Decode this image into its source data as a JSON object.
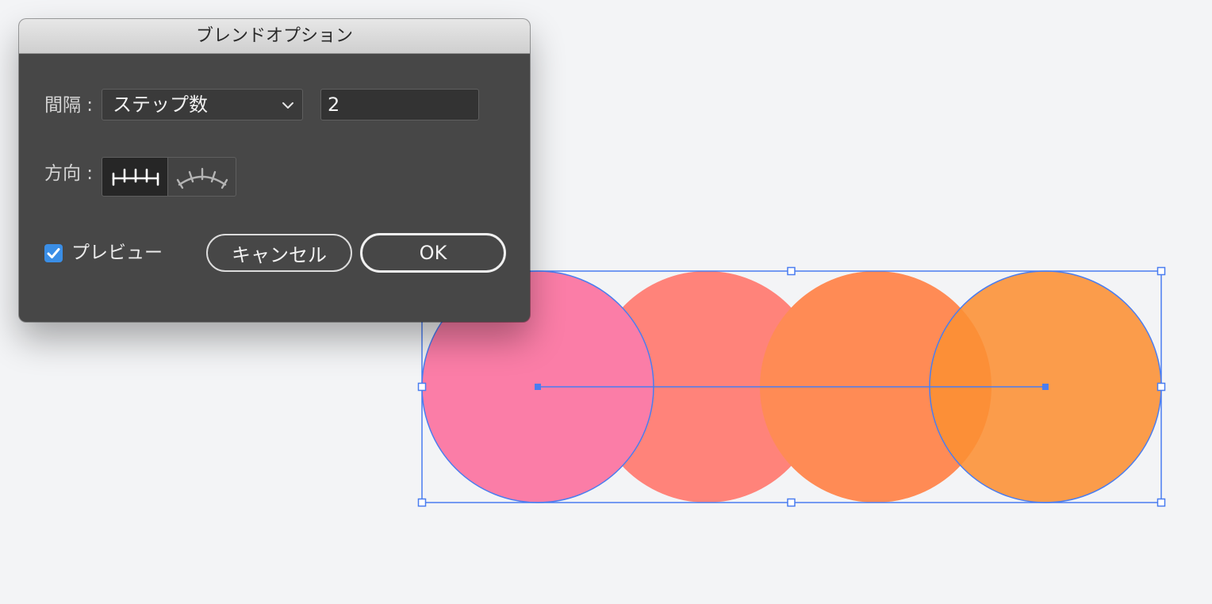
{
  "dialog": {
    "title": "ブレンドオプション",
    "spacing_label": "間隔 :",
    "spacing_option": "ステップ数",
    "steps_value": "2",
    "orientation_label": "方向 :",
    "orientation_options": [
      "align-to-page-icon",
      "align-to-path-icon"
    ],
    "orientation_selected": "align-to-page-icon",
    "preview_label": "プレビュー",
    "preview_checked": true,
    "cancel_label": "キャンセル",
    "ok_label": "OK"
  },
  "colors": {
    "dialog_bg": "#474747",
    "accent": "#3a8ee6",
    "selection": "#4a7df0"
  },
  "canvas": {
    "blend_steps": 2,
    "circles": [
      {
        "role": "start-object",
        "fill": "#fb7da7"
      },
      {
        "role": "blend-step",
        "fill": "#ff837a"
      },
      {
        "role": "blend-step",
        "fill": "#ff8b55"
      },
      {
        "role": "end-object",
        "fill": "#fc8f33"
      }
    ]
  }
}
